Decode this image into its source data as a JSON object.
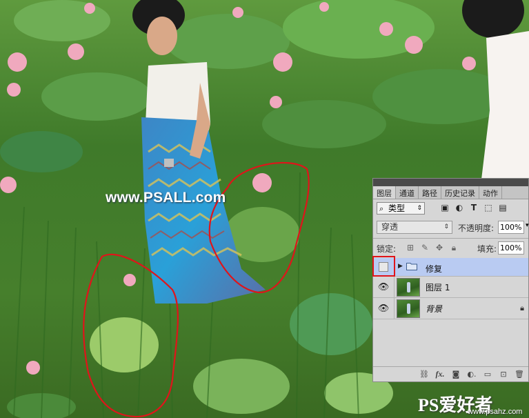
{
  "watermark": "www.PSALL.com",
  "corner_logo": {
    "big": "PS爱好者",
    "url": "www.psahz.com"
  },
  "layers_panel": {
    "tabs": [
      "图层",
      "通道",
      "路径",
      "历史记录",
      "动作"
    ],
    "filter_kind": "类型",
    "blend_mode": "穿透",
    "opacity_label": "不透明度:",
    "opacity_value": "100%",
    "lock_label": "锁定:",
    "fill_label": "填充:",
    "fill_value": "100%",
    "layers": [
      {
        "name": "修复",
        "type": "group",
        "visible": false,
        "selected": true
      },
      {
        "name": "图层 1",
        "type": "pixel",
        "visible": true,
        "selected": false
      },
      {
        "name": "背景",
        "type": "background",
        "visible": true,
        "locked": true
      }
    ]
  },
  "colors": {
    "annotation": "#e0141a",
    "selection": "#b9cbf2"
  }
}
